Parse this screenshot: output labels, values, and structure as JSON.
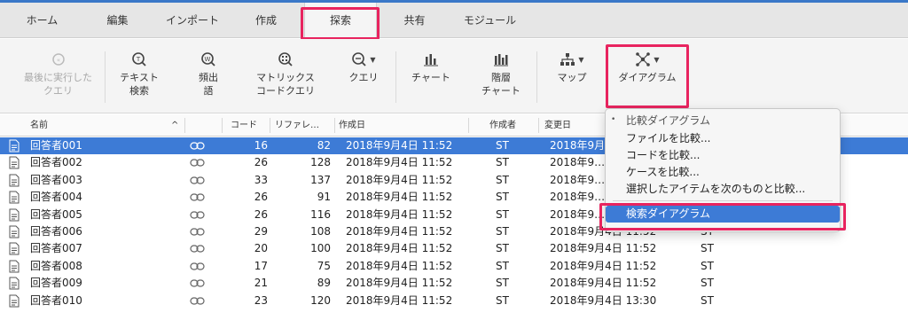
{
  "tabs": [
    {
      "label": "ホーム"
    },
    {
      "label": "編集"
    },
    {
      "label": "インポート"
    },
    {
      "label": "作成"
    },
    {
      "label": "探索"
    },
    {
      "label": "共有"
    },
    {
      "label": "モジュール"
    }
  ],
  "active_tab": "探索",
  "ribbon": {
    "last_query": "最後に実行した\nクエリ",
    "text_search": "テキスト\n検索",
    "word_freq": "頻出\n語",
    "matrix": "マトリックス\nコードクエリ",
    "query": "クエリ",
    "chart": "チャート",
    "hier_chart": "階層\nチャート",
    "map": "マップ",
    "diagram": "ダイアグラム"
  },
  "columns": {
    "name": "名前",
    "code": "コード",
    "refs": "リファレ…",
    "created": "作成日",
    "creator": "作成者",
    "modified": "変更日"
  },
  "rows": [
    {
      "name": "回答者001",
      "code": "16",
      "refs": "82",
      "created": "2018年9月4日 11:52",
      "creator": "ST",
      "modified": "2018年9月",
      "modifier": ""
    },
    {
      "name": "回答者002",
      "code": "26",
      "refs": "128",
      "created": "2018年9月4日 11:52",
      "creator": "ST",
      "modified": "2018年9…",
      "modifier": ""
    },
    {
      "name": "回答者003",
      "code": "33",
      "refs": "137",
      "created": "2018年9月4日 11:52",
      "creator": "ST",
      "modified": "2018年9…",
      "modifier": ""
    },
    {
      "name": "回答者004",
      "code": "26",
      "refs": "91",
      "created": "2018年9月4日 11:52",
      "creator": "ST",
      "modified": "2018年9…",
      "modifier": ""
    },
    {
      "name": "回答者005",
      "code": "26",
      "refs": "116",
      "created": "2018年9月4日 11:52",
      "creator": "ST",
      "modified": "2018年9…",
      "modifier": ""
    },
    {
      "name": "回答者006",
      "code": "29",
      "refs": "108",
      "created": "2018年9月4日 11:52",
      "creator": "ST",
      "modified": "2018年9月4日 11:52",
      "modifier": "ST"
    },
    {
      "name": "回答者007",
      "code": "20",
      "refs": "100",
      "created": "2018年9月4日 11:52",
      "creator": "ST",
      "modified": "2018年9月4日 11:52",
      "modifier": "ST"
    },
    {
      "name": "回答者008",
      "code": "17",
      "refs": "75",
      "created": "2018年9月4日 11:52",
      "creator": "ST",
      "modified": "2018年9月4日 11:52",
      "modifier": "ST"
    },
    {
      "name": "回答者009",
      "code": "21",
      "refs": "89",
      "created": "2018年9月4日 11:52",
      "creator": "ST",
      "modified": "2018年9月4日 11:52",
      "modifier": "ST"
    },
    {
      "name": "回答者010",
      "code": "23",
      "refs": "120",
      "created": "2018年9月4日 11:52",
      "creator": "ST",
      "modified": "2018年9月4日 13:30",
      "modifier": "ST"
    }
  ],
  "menu": {
    "header": "比較ダイアグラム",
    "items": [
      "ファイルを比較...",
      "コードを比較...",
      "ケースを比較...",
      "選択したアイテムを次のものと比較..."
    ],
    "active": "検索ダイアグラム"
  },
  "colors": {
    "highlight": "#e8245f",
    "selection": "#3d7bd6"
  }
}
